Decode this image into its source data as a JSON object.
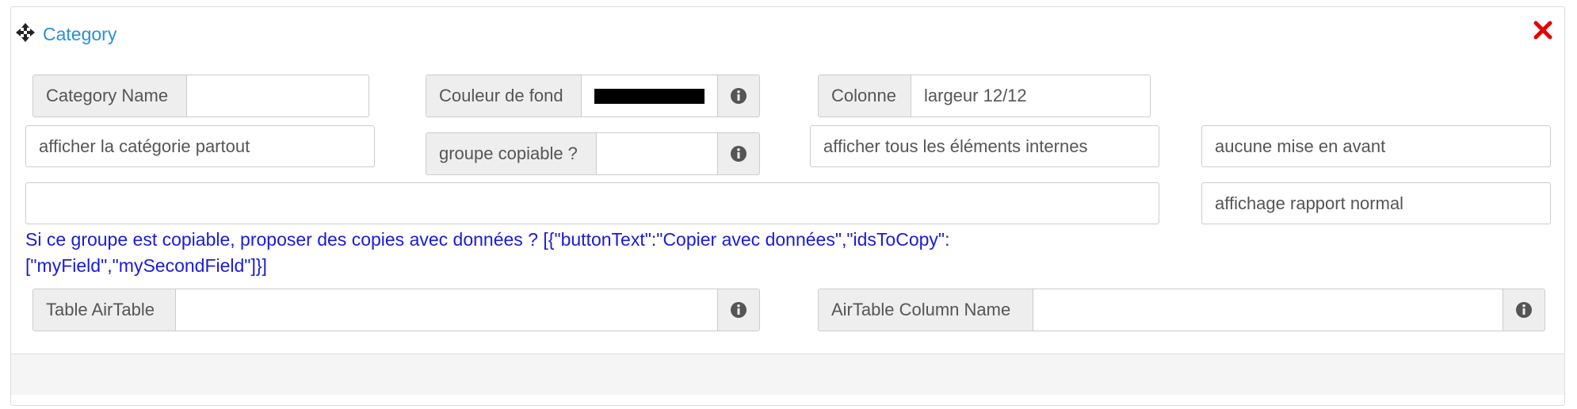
{
  "header": {
    "title": "Category"
  },
  "row1": {
    "category_name_label": "Category Name",
    "category_name_value": "",
    "bg_color_label": "Couleur de fond",
    "bg_color_value": "#000000",
    "column_label": "Colonne",
    "column_value": "largeur 12/12"
  },
  "row2": {
    "display_category_select": "afficher la catégorie partout",
    "copiable_group_label": "groupe copiable ?",
    "copiable_group_value": "",
    "show_internal_select": "afficher tous les éléments internes",
    "highlight_select": "aucune mise en avant"
  },
  "row3": {
    "copies_textarea_value": "",
    "report_display_select": "affichage rapport normal"
  },
  "help_text": "Si ce groupe est copiable, proposer des copies avec données ? [{\"buttonText\":\"Copier avec données\",\"idsToCopy\":[\"myField\",\"mySecondField\"]}]",
  "row4": {
    "airtable_table_label": "Table AirTable",
    "airtable_table_value": "",
    "airtable_column_label": "AirTable Column Name",
    "airtable_column_value": ""
  },
  "colors": {
    "accent": "#2c8fd8",
    "close": "#e60000",
    "help_text": "#1a1adf"
  }
}
